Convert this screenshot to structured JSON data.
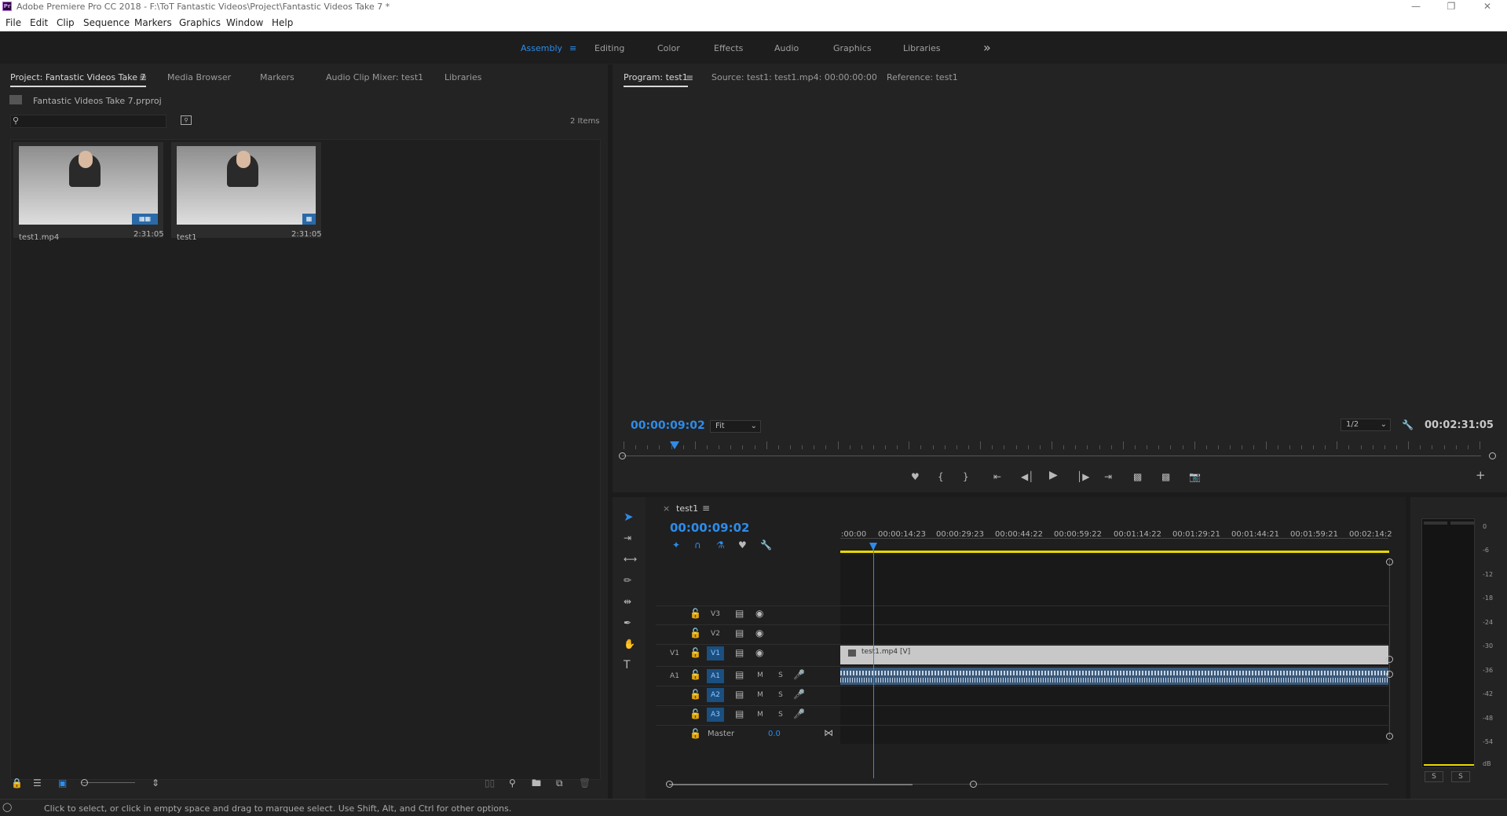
{
  "window": {
    "title": "Adobe Premiere Pro CC 2018 - F:\\ToT Fantastic Videos\\Project\\Fantastic Videos Take 7 *",
    "logo": "Pr"
  },
  "menu": [
    "File",
    "Edit",
    "Clip",
    "Sequence",
    "Markers",
    "Graphics",
    "Window",
    "Help"
  ],
  "workspaces": {
    "items": [
      "Assembly",
      "Editing",
      "Color",
      "Effects",
      "Audio",
      "Graphics",
      "Libraries"
    ],
    "active": "Assembly",
    "more": "»"
  },
  "project_panel": {
    "tabs": [
      "Project: Fantastic Videos Take 7",
      "Media Browser",
      "Markers",
      "Audio Clip Mixer: test1",
      "Libraries"
    ],
    "file": "Fantastic Videos Take 7.prproj",
    "search_placeholder": "",
    "count": "2 Items",
    "items": [
      {
        "name": "test1.mp4",
        "duration": "2:31:05"
      },
      {
        "name": "test1",
        "duration": "2:31:05"
      }
    ]
  },
  "program_monitor": {
    "tabs": [
      "Program: test1",
      "Source: test1: test1.mp4: 00:00:00:00",
      "Reference: test1"
    ],
    "timecode": "00:00:09:02",
    "zoom": "Fit",
    "quality": "1/2",
    "duration": "00:02:31:05",
    "playhead_fraction": 0.06
  },
  "timeline": {
    "sequence": "test1",
    "close": "×",
    "timecode": "00:00:09:02",
    "ruler": [
      ":00:00",
      "00:00:14:23",
      "00:00:29:23",
      "00:00:44:22",
      "00:00:59:22",
      "00:01:14:22",
      "00:01:29:21",
      "00:01:44:21",
      "00:01:59:21",
      "00:02:14:2"
    ],
    "video_tracks": [
      {
        "name": "V3",
        "src": ""
      },
      {
        "name": "V2",
        "src": ""
      },
      {
        "name": "V1",
        "src": "V1",
        "clip": "test1.mp4 [V]"
      }
    ],
    "audio_tracks": [
      {
        "name": "A1",
        "src": "A1",
        "m": "M",
        "s": "S"
      },
      {
        "name": "A2",
        "src": "",
        "m": "M",
        "s": "S"
      },
      {
        "name": "A3",
        "src": "",
        "m": "M",
        "s": "S"
      }
    ],
    "master": {
      "label": "Master",
      "value": "0.0"
    }
  },
  "audio_meter": {
    "scale": [
      "0",
      "-6",
      "-12",
      "-18",
      "-24",
      "-30",
      "-36",
      "-42",
      "-48",
      "-54",
      "dB"
    ],
    "solo": [
      "S",
      "S"
    ]
  },
  "status": "Click to select, or click in empty space and drag to marquee select. Use Shift, Alt, and Ctrl for other options.",
  "colors": {
    "accent": "#2d8ceb",
    "work_area": "#e8d800",
    "clip_video": "#c8c8c8",
    "track_active": "#1a4f80"
  }
}
